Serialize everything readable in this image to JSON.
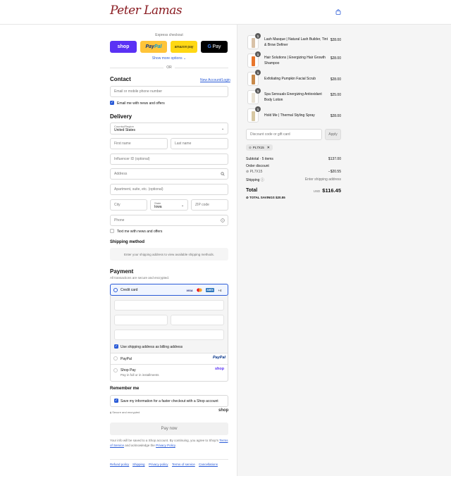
{
  "brand": {
    "logo_text": "Peter Lamas"
  },
  "express": {
    "label": "Express checkout",
    "buttons": {
      "shop_pay": "shop",
      "paypal_a": "Pay",
      "paypal_b": "Pal",
      "amazon_a": "amazon",
      "amazon_b": "pay",
      "gpay_a": "G",
      "gpay_b": "Pay"
    },
    "show_more": "Show more options",
    "or": "OR"
  },
  "contact": {
    "title": "Contact",
    "login_link": "New Account/Login",
    "email_placeholder": "Email or mobile phone number",
    "newsletter_label": "Email me with news and offers"
  },
  "delivery": {
    "title": "Delivery",
    "country_label": "Country/Region",
    "country_value": "United States",
    "first_name": "First name",
    "last_name": "Last name",
    "influencer": "Influencer ID (optional)",
    "address": "Address",
    "apartment": "Apartment, suite, etc. (optional)",
    "city": "City",
    "state_label": "State",
    "state_value": "Iowa",
    "zip": "ZIP code",
    "phone": "Phone",
    "text_offers": "Text me with news and offers"
  },
  "shipping_method": {
    "title": "Shipping method",
    "message": "Enter your shipping address to view available shipping methods."
  },
  "payment": {
    "title": "Payment",
    "subtitle": "All transactions are secure and encrypted.",
    "credit_card": "Credit card",
    "card_logos": {
      "visa": "VISA",
      "amex": "AMEX",
      "more": "+4"
    },
    "billing_same": "Use shipping address as billing address",
    "paypal": "PayPal",
    "paypal_logo": "PayPal",
    "shop_pay": "Shop Pay",
    "shop_pay_sub": "Pay in full or in installments",
    "shop_pay_logo": "shop"
  },
  "remember": {
    "title": "Remember me",
    "save_label": "Save my information for a faster checkout with a Shop account",
    "secure": "Secure and encrypted",
    "shop_logo": "shop"
  },
  "pay_now": "Pay now",
  "legal": {
    "line1": "Your info will be saved to a Shop account. By continuing, you agree to Shop's",
    "terms": "Terms of Service",
    "and": "and acknowledge the",
    "privacy": "Privacy Policy",
    "period": "."
  },
  "footer_links": [
    "Refund policy",
    "Shipping",
    "Privacy policy",
    "Terms of service",
    "Cancellations"
  ],
  "cart": {
    "items": [
      {
        "qty": "1",
        "name": "Lash Masque | Natural Lash Builder, Tint & Brow Definer",
        "price": "$28.00",
        "color": "#d9c2a8"
      },
      {
        "qty": "1",
        "name": "Hair Solutions | Energizing Hair Growth Shampoo",
        "price": "$28.00",
        "color": "#e8762c"
      },
      {
        "qty": "1",
        "name": "Exfoliating Pumpkin Facial Scrub",
        "price": "$28.00",
        "color": "#c98a4a"
      },
      {
        "qty": "1",
        "name": "Spa Sensuals Energizing Antioxidant Body Lotion",
        "price": "$25.00",
        "color": "#e9e2d4"
      },
      {
        "qty": "1",
        "name": "Hold Me | Thermal Styling Spray",
        "price": "$28.00",
        "color": "#d7c8a3"
      }
    ],
    "discount_placeholder": "Discount code or gift card",
    "apply": "Apply",
    "code_chip": "PL7X15",
    "subtotal_label": "Subtotal · 5 items",
    "subtotal_value": "$137.00",
    "order_discount_label": "Order discount",
    "discount_code": "PL7X15",
    "discount_value": "−$20.55",
    "shipping_label": "Shipping",
    "shipping_value": "Enter shipping address",
    "total_label": "Total",
    "currency": "USD",
    "total_value": "$116.45",
    "savings_label": "TOTAL SAVINGS",
    "savings_value": "$20.55"
  },
  "colors": {
    "accent": "#2a5bd7",
    "shop_purple": "#5a31f4",
    "paypal_yellow": "#ffc439",
    "amazon_yellow": "#ffd814",
    "brand_red": "#8a1c22"
  }
}
